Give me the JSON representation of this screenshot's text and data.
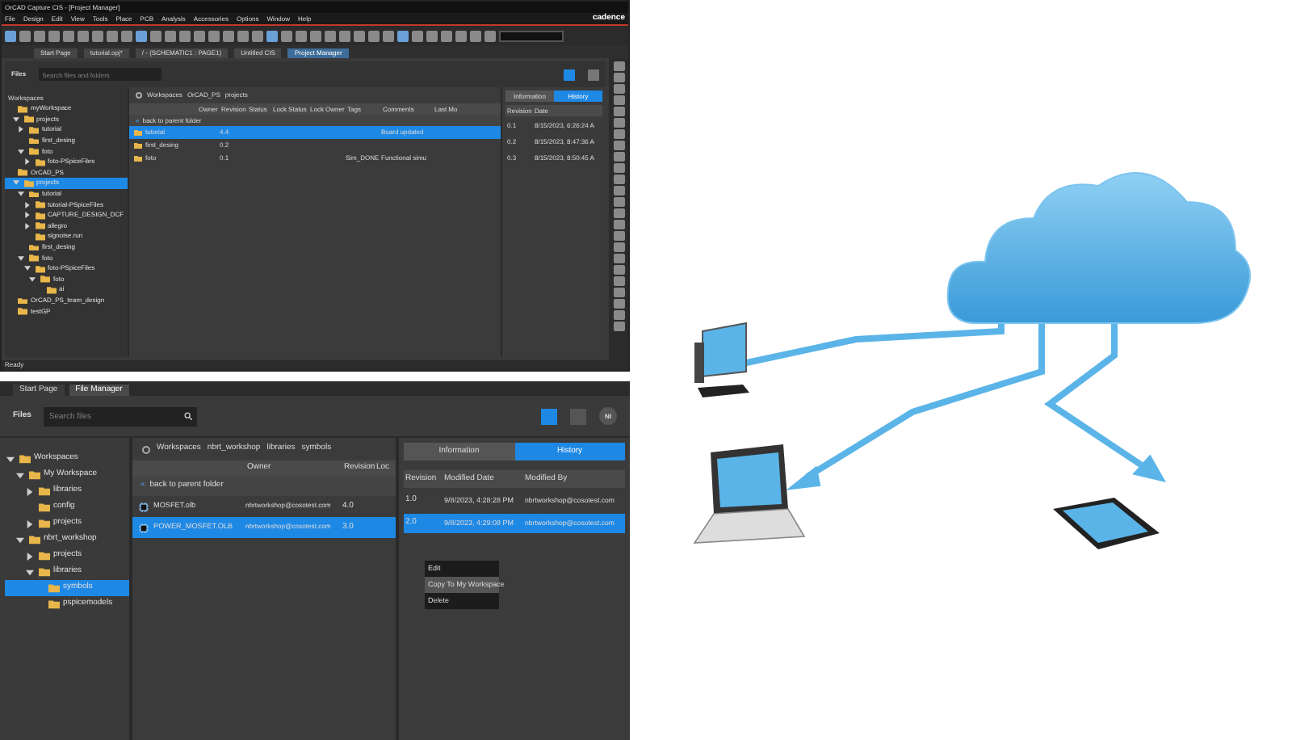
{
  "top_window": {
    "title": "OrCAD Capture CIS - [Project Manager]",
    "logo": "cadence",
    "menu": [
      "File",
      "Design",
      "Edit",
      "View",
      "Tools",
      "Place",
      "PCB",
      "Analysis",
      "Accessories",
      "Options",
      "Window",
      "Help"
    ],
    "doc_tabs": [
      {
        "label": "Start Page",
        "selected": false
      },
      {
        "label": "tutorial.opj*",
        "selected": false
      },
      {
        "label": "/ - (SCHEMATIC1 : PAGE1)",
        "selected": false
      },
      {
        "label": "Untitled CIS",
        "selected": false
      },
      {
        "label": "Project Manager",
        "selected": true
      }
    ],
    "files_label": "Files",
    "search": {
      "placeholder": "Search files and folders"
    },
    "tree_header": "Workspaces",
    "tree": [
      {
        "label": "myWorkspace",
        "selected": false,
        "children": [
          {
            "label": "projects",
            "selected": false,
            "expanded": true,
            "children": [
              {
                "label": "tutorial",
                "selected": false,
                "expanded": false
              },
              {
                "label": "first_desing",
                "selected": false
              },
              {
                "label": "foto",
                "selected": false,
                "expanded": true,
                "children": [
                  {
                    "label": "foto-PSpiceFiles",
                    "selected": false,
                    "expanded": false
                  }
                ]
              }
            ]
          }
        ]
      },
      {
        "label": "OrCAD_PS",
        "selected": false,
        "children": [
          {
            "label": "projects",
            "selected": true,
            "expanded": true,
            "children": [
              {
                "label": "tutorial",
                "selected": false,
                "expanded": true,
                "children": [
                  {
                    "label": "tutorial-PSpiceFiles",
                    "selected": false,
                    "expanded": false
                  },
                  {
                    "label": "CAPTURE_DESIGN_DCF",
                    "selected": false,
                    "expanded": false
                  },
                  {
                    "label": "allegro",
                    "selected": false,
                    "expanded": false
                  },
                  {
                    "label": "signoise.run",
                    "selected": false
                  }
                ]
              },
              {
                "label": "first_desing",
                "selected": false
              },
              {
                "label": "foto",
                "selected": false,
                "expanded": true,
                "children": [
                  {
                    "label": "foto-PSpiceFiles",
                    "selected": false,
                    "expanded": true,
                    "children": [
                      {
                        "label": "foto",
                        "selected": false,
                        "expanded": true,
                        "children": [
                          {
                            "label": "ai",
                            "selected": false
                          }
                        ]
                      }
                    ]
                  }
                ]
              }
            ]
          }
        ]
      },
      {
        "label": "OrCAD_PS_team_design",
        "selected": false
      },
      {
        "label": "testGP",
        "selected": false
      }
    ],
    "breadcrumb": [
      "Workspaces",
      "OrCAD_PS",
      "projects"
    ],
    "columns": [
      "Owner",
      "Revision",
      "Status",
      "Lock Status",
      "Lock Owner",
      "Tags",
      "Comments",
      "Last Mo"
    ],
    "back_label": "back to parent folder",
    "back_icon": "«",
    "rows": [
      {
        "name": "tutorial",
        "revision": "4.4",
        "comments": "Board updated",
        "selected": true
      },
      {
        "name": "first_desing",
        "revision": "0.2",
        "selected": false
      },
      {
        "name": "foto",
        "revision": "0.1",
        "tags": "Sim_DONE",
        "comments": "Functional simu",
        "selected": false
      }
    ],
    "panel_tabs": [
      {
        "label": "Information",
        "selected": false
      },
      {
        "label": "History",
        "selected": true
      }
    ],
    "history_columns": [
      "Revision",
      "Date"
    ],
    "history": [
      {
        "revision": "0.1",
        "date": "8/15/2023, 6:26:24 A",
        "selected": false
      },
      {
        "revision": "0.2",
        "date": "8/15/2023, 8:47:36 A",
        "selected": false
      },
      {
        "revision": "0.3",
        "date": "8/15/2023, 8:50:45 A",
        "selected": false
      }
    ],
    "status": "Ready"
  },
  "bottom_window": {
    "doc_tabs": [
      {
        "label": "Start Page",
        "selected": false
      },
      {
        "label": "File Manager",
        "selected": true
      }
    ],
    "files_label": "Files",
    "search": {
      "placeholder": "Search files"
    },
    "avatar": "NI",
    "tree": [
      {
        "label": "Workspaces",
        "selected": false,
        "expanded": true,
        "children": [
          {
            "label": "My Workspace",
            "selected": false,
            "expanded": true,
            "children": [
              {
                "label": "libraries",
                "selected": false,
                "expanded": false
              },
              {
                "label": "config",
                "selected": false
              },
              {
                "label": "projects",
                "selected": false,
                "expanded": false
              }
            ]
          },
          {
            "label": "nbrt_workshop",
            "selected": false,
            "expanded": true,
            "children": [
              {
                "label": "projects",
                "selected": false,
                "expanded": false
              },
              {
                "label": "libraries",
                "selected": false,
                "expanded": true,
                "children": [
                  {
                    "label": "symbols",
                    "selected": true
                  },
                  {
                    "label": "pspicemodels",
                    "selected": false
                  }
                ]
              }
            ]
          }
        ]
      }
    ],
    "breadcrumb": [
      "Workspaces",
      "nbrt_workshop",
      "libraries",
      "symbols"
    ],
    "columns": [
      "Owner",
      "Revision",
      "Loc"
    ],
    "back_label": "back to parent folder",
    "back_icon": "«",
    "rows": [
      {
        "name": "MOSFET.olb",
        "owner": "nbrtworkshop@cosotest.com",
        "revision": "4.0",
        "selected": false
      },
      {
        "name": "POWER_MOSFET.OLB",
        "owner": "nbrtworkshop@cosotest.com",
        "revision": "3.0",
        "selected": true
      }
    ],
    "panel_tabs": [
      {
        "label": "Information",
        "selected": false
      },
      {
        "label": "History",
        "selected": true
      }
    ],
    "history_columns": [
      "Revision",
      "Modified Date",
      "Modified By"
    ],
    "history": [
      {
        "revision": "1.0",
        "date": "9/8/2023, 4:28:28 PM",
        "by": "nbrtworkshop@cosotest.com",
        "selected": false
      },
      {
        "revision": "2.0",
        "date": "9/8/2023, 4:29:08 PM",
        "by": "nbrtworkshop@cosotest.com",
        "selected": true
      }
    ],
    "context_menu": [
      {
        "label": "Edit",
        "hovered": false
      },
      {
        "label": "Copy To My Workspace",
        "hovered": true
      },
      {
        "label": "Delete",
        "hovered": false
      }
    ]
  }
}
